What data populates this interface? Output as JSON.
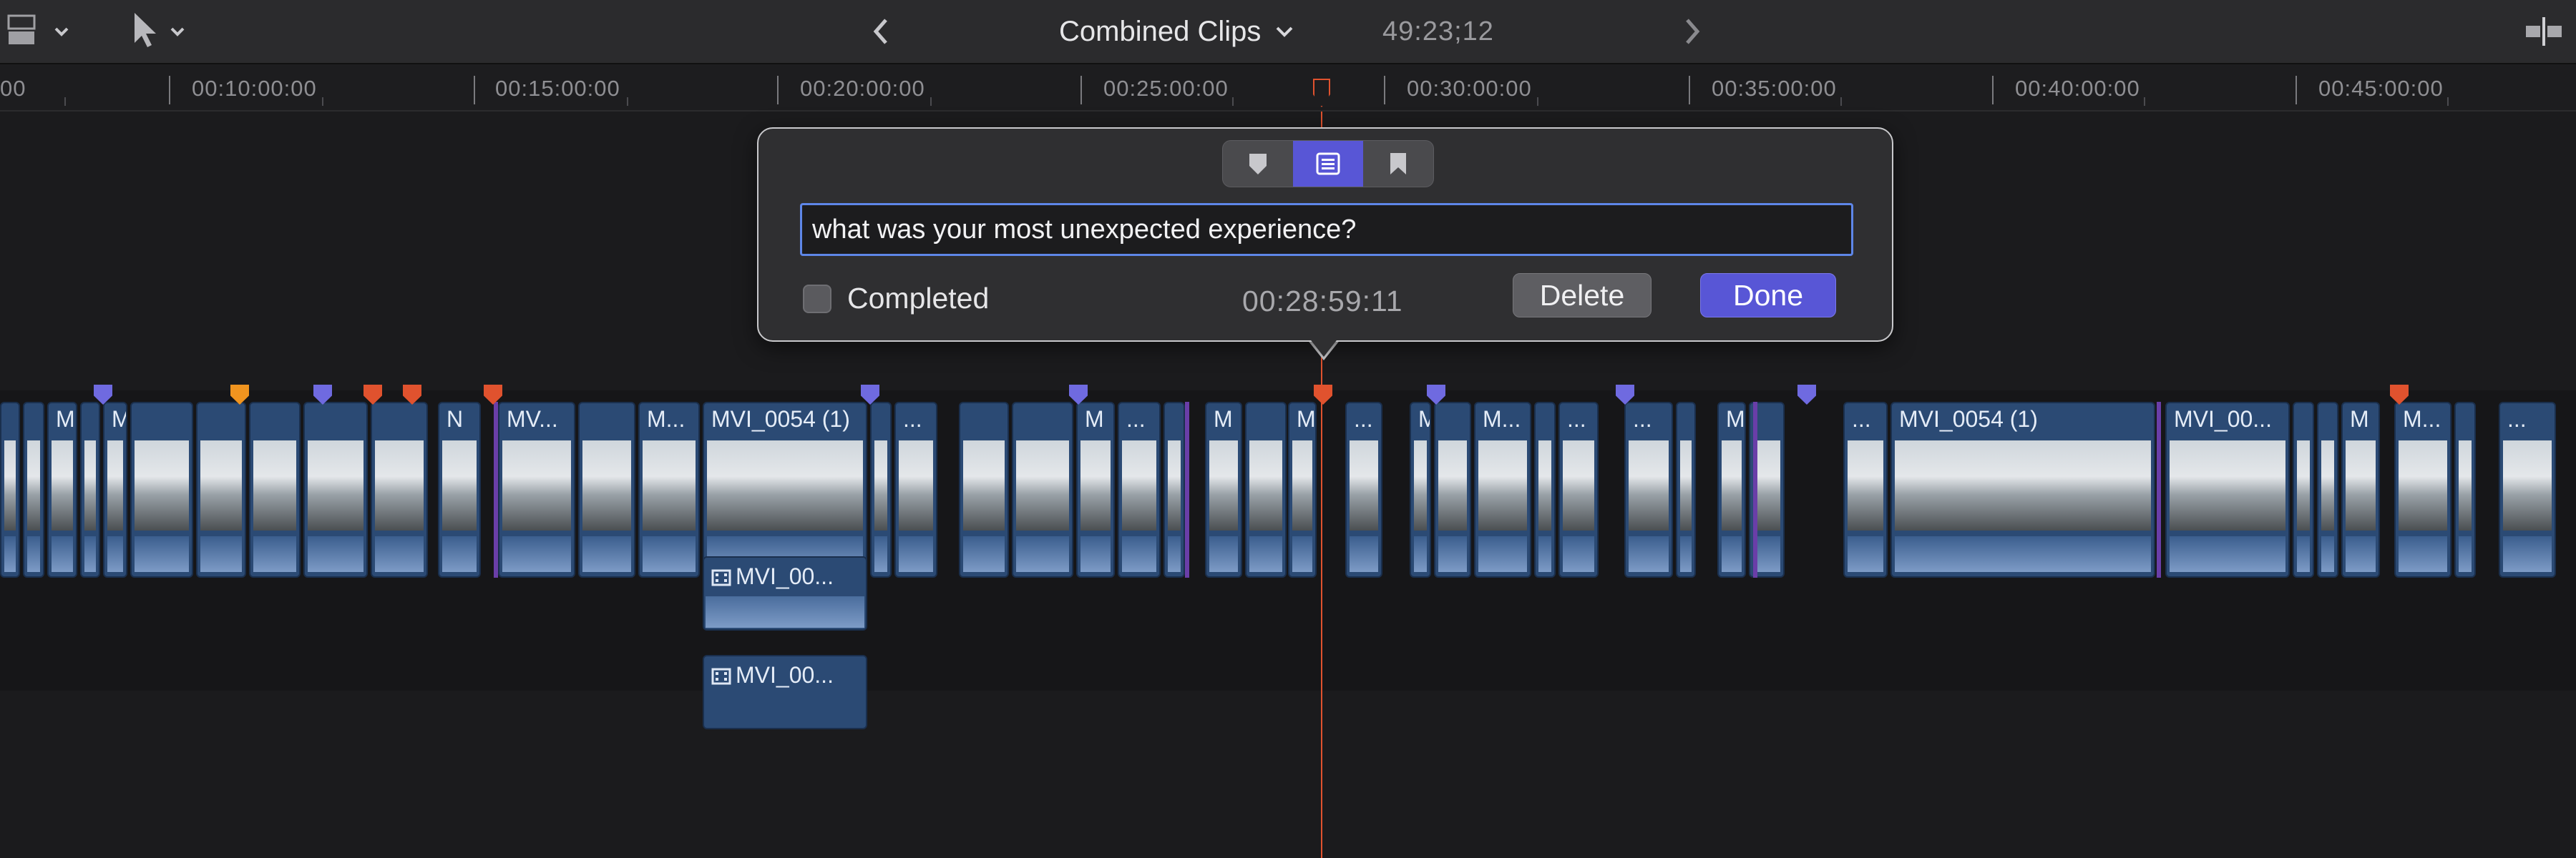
{
  "toolbar": {
    "project_title": "Combined Clips",
    "duration": "49:23;12"
  },
  "ruler": {
    "labels": [
      "00",
      "00:10:00:00",
      "00:15:00:00",
      "00:20:00:00",
      "00:25:00:00",
      "00:30:00:00",
      "00:35:00:00",
      "00:40:00:00",
      "00:45:00:00"
    ]
  },
  "timeline": {
    "clips": [
      {
        "name": "M"
      },
      {
        "name": "M"
      },
      {
        "name": "N"
      },
      {
        "name": "MV..."
      },
      {
        "name": "M..."
      },
      {
        "name": "MVI_0054 (1)"
      },
      {
        "name": "..."
      },
      {
        "name": "M"
      },
      {
        "name": "..."
      },
      {
        "name": "M"
      },
      {
        "name": "M"
      },
      {
        "name": "..."
      },
      {
        "name": "M"
      },
      {
        "name": "M..."
      },
      {
        "name": "..."
      },
      {
        "name": "..."
      },
      {
        "name": "M"
      },
      {
        "name": "..."
      },
      {
        "name": "MVI_0054 (1)"
      },
      {
        "name": "MVI_00..."
      },
      {
        "name": "M"
      },
      {
        "name": "M..."
      },
      {
        "name": "..."
      }
    ],
    "connected_clips": [
      {
        "name": "MVI_00..."
      },
      {
        "name": "MVI_00..."
      }
    ]
  },
  "popover": {
    "note_value": "what was your most unexpected experience?",
    "completed_label": "Completed",
    "completed": false,
    "timecode": "00:28:59:11",
    "delete_label": "Delete",
    "done_label": "Done",
    "active_marker_type": "to-do"
  },
  "colors": {
    "accent": "#5856d6",
    "playhead": "#e0522e",
    "clip": "#2b4a74",
    "marker_standard": "#6f6ae0",
    "marker_todo": "#e0522e",
    "marker_chapter": "#f0941f"
  }
}
